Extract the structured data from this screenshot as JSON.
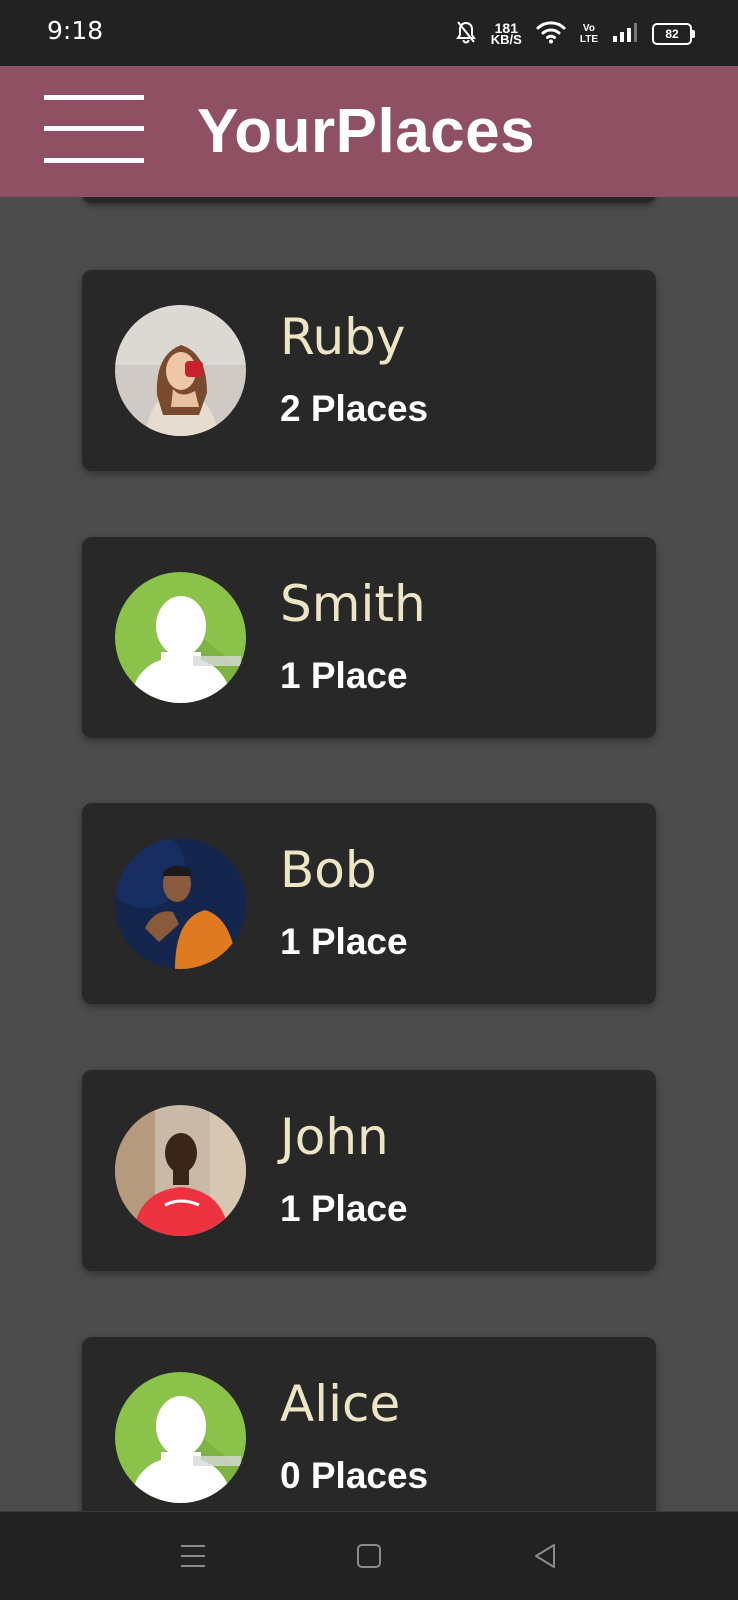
{
  "status_bar": {
    "time": "9:18",
    "speed_value": "181",
    "speed_unit": "KB/S",
    "volte_top": "Vo",
    "volte_bottom": "LTE",
    "battery": "82"
  },
  "app_bar": {
    "title": "YourPlaces"
  },
  "users": [
    {
      "name": "Ruby",
      "places": "2 Places",
      "avatar": "photo-woman-icon"
    },
    {
      "name": "Smith",
      "places": "1 Place",
      "avatar": "default-user-icon"
    },
    {
      "name": "Bob",
      "places": "1 Place",
      "avatar": "photo-man-icon"
    },
    {
      "name": "John",
      "places": "1 Place",
      "avatar": "photo-man-icon"
    },
    {
      "name": "Alice",
      "places": "0 Places",
      "avatar": "default-user-icon"
    }
  ],
  "colors": {
    "app_bar": "#8e5062",
    "card": "#282828",
    "background": "#4c4c4c",
    "name_text": "#ece6c5",
    "default_avatar": "#8bc34a"
  }
}
